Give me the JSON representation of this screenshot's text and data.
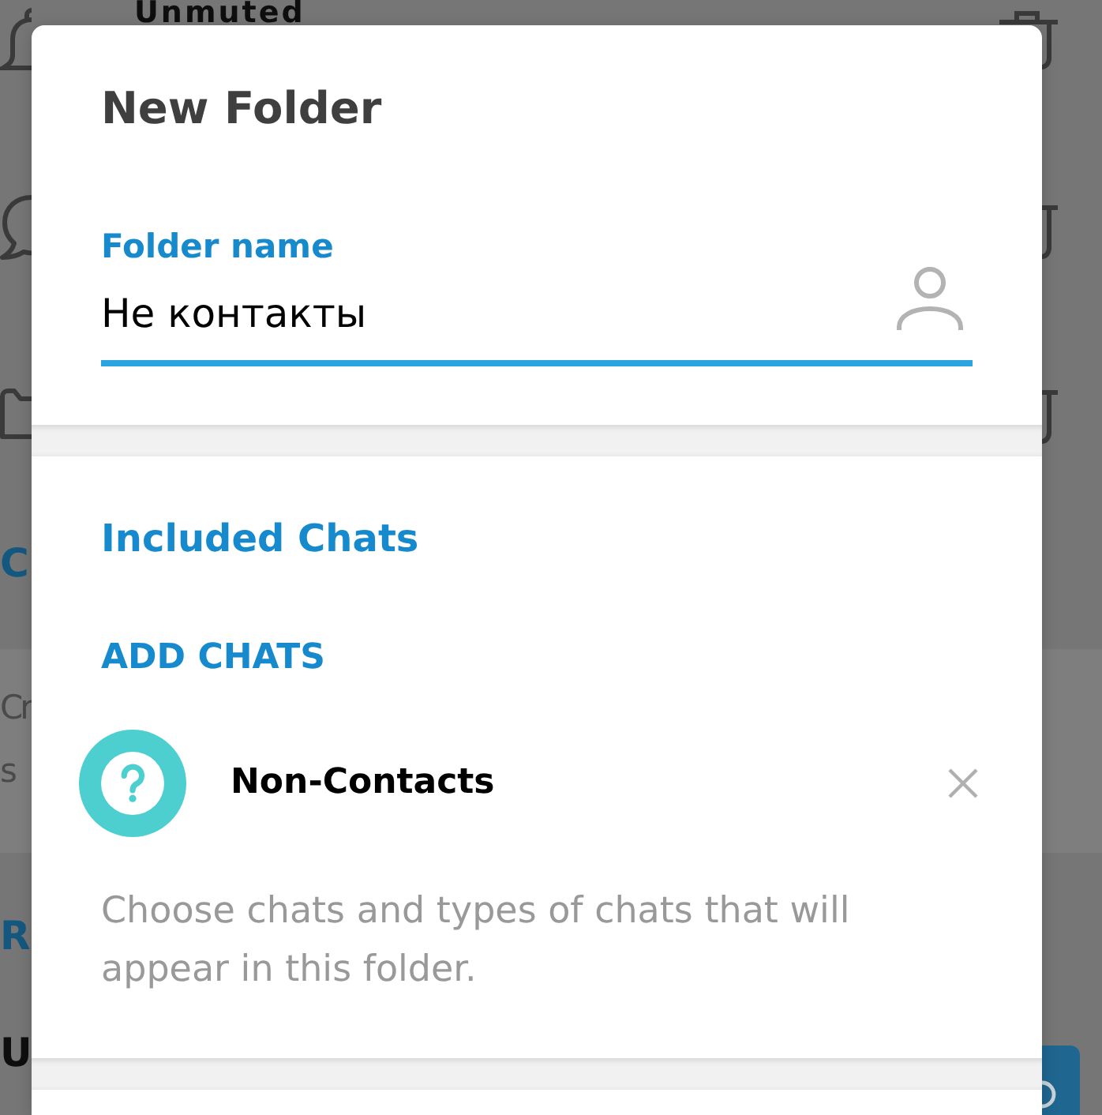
{
  "background": {
    "top_item_title": "Unmuted",
    "heading_fragment": "C",
    "hint_fragments": [
      "Cr",
      "s"
    ],
    "lower_heading_fragment": "R",
    "lower_item_fragment": "U"
  },
  "dialog": {
    "title": "New Folder",
    "name_field": {
      "label": "Folder name",
      "value": "Не контакты",
      "focused": true
    },
    "included_chats": {
      "heading": "Included Chats",
      "add_button": "ADD CHATS",
      "chats": [
        {
          "name": "Non-Contacts"
        }
      ],
      "hint": "Choose chats and types of chats that will appear in this folder."
    }
  }
}
